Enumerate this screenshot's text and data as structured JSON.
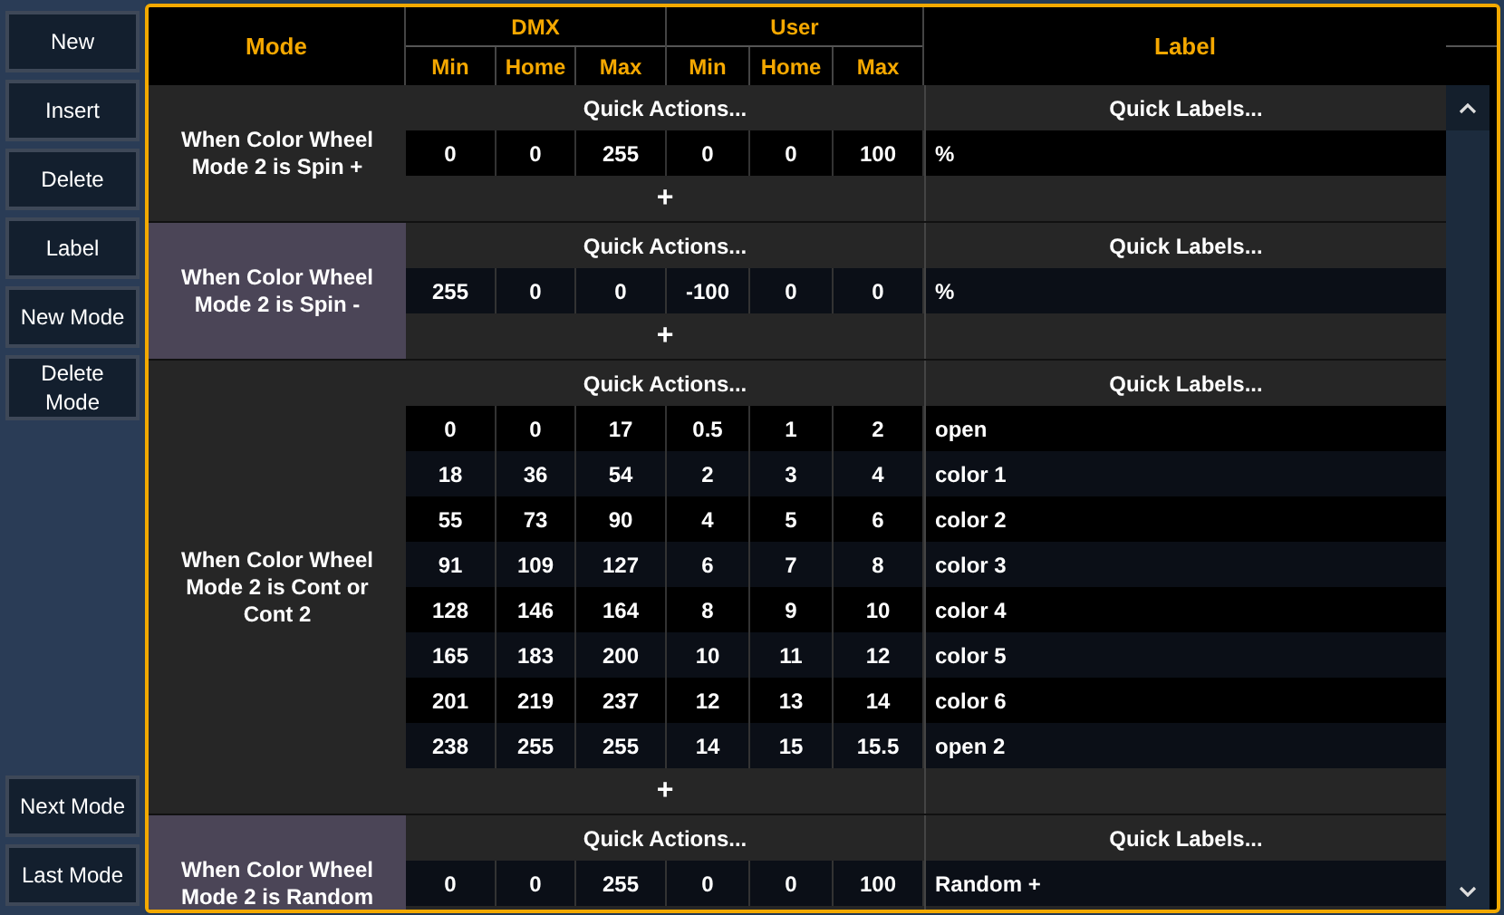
{
  "sidebar": {
    "top_buttons": [
      "New",
      "Insert",
      "Delete",
      "Label",
      "New Mode",
      "Delete Mode"
    ],
    "bottom_buttons": [
      "Next Mode",
      "Last Mode"
    ]
  },
  "header": {
    "mode": "Mode",
    "groups": [
      {
        "title": "DMX",
        "columns": [
          "Min",
          "Home",
          "Max"
        ]
      },
      {
        "title": "User",
        "columns": [
          "Min",
          "Home",
          "Max"
        ]
      }
    ],
    "label": "Label"
  },
  "modes": [
    {
      "name": "When Color Wheel Mode 2 is Spin +",
      "selected": false,
      "quick_actions": "Quick Actions...",
      "quick_labels": "Quick Labels...",
      "add": "+",
      "rows": [
        {
          "values": [
            "0",
            "0",
            "255",
            "0",
            "0",
            "100"
          ],
          "label": "%"
        }
      ]
    },
    {
      "name": "When Color Wheel Mode 2 is Spin -",
      "selected": true,
      "quick_actions": "Quick Actions...",
      "quick_labels": "Quick Labels...",
      "add": "+",
      "rows": [
        {
          "values": [
            "255",
            "0",
            "0",
            "-100",
            "0",
            "0"
          ],
          "label": "%"
        }
      ]
    },
    {
      "name": "When Color Wheel Mode 2 is Cont or Cont 2",
      "selected": false,
      "quick_actions": "Quick Actions...",
      "quick_labels": "Quick Labels...",
      "add": "+",
      "rows": [
        {
          "values": [
            "0",
            "0",
            "17",
            "0.5",
            "1",
            "2"
          ],
          "label": "open"
        },
        {
          "values": [
            "18",
            "36",
            "54",
            "2",
            "3",
            "4"
          ],
          "label": "color 1"
        },
        {
          "values": [
            "55",
            "73",
            "90",
            "4",
            "5",
            "6"
          ],
          "label": "color 2"
        },
        {
          "values": [
            "91",
            "109",
            "127",
            "6",
            "7",
            "8"
          ],
          "label": "color 3"
        },
        {
          "values": [
            "128",
            "146",
            "164",
            "8",
            "9",
            "10"
          ],
          "label": "color 4"
        },
        {
          "values": [
            "165",
            "183",
            "200",
            "10",
            "11",
            "12"
          ],
          "label": "color 5"
        },
        {
          "values": [
            "201",
            "219",
            "237",
            "12",
            "13",
            "14"
          ],
          "label": "color 6"
        },
        {
          "values": [
            "238",
            "255",
            "255",
            "14",
            "15",
            "15.5"
          ],
          "label": "open 2"
        }
      ]
    },
    {
      "name": "When Color Wheel Mode 2 is Random",
      "selected": true,
      "quick_actions": "Quick Actions...",
      "quick_labels": "Quick Labels...",
      "rows": [
        {
          "values": [
            "0",
            "0",
            "255",
            "0",
            "0",
            "100"
          ],
          "label": "Random +"
        }
      ]
    }
  ]
}
